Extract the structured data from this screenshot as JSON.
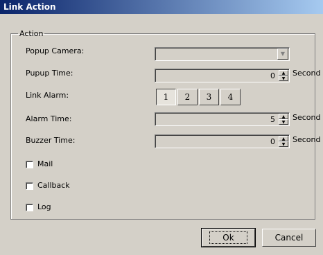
{
  "window": {
    "title": "Link Action"
  },
  "group": {
    "legend": "Action"
  },
  "popup_camera": {
    "label": "Popup Camera:",
    "value": ""
  },
  "popup_time": {
    "label": "Pupup Time:",
    "value": "0",
    "unit": "Second"
  },
  "link_alarm": {
    "label": "Link Alarm:",
    "buttons": [
      "1",
      "2",
      "3",
      "4"
    ],
    "selected": "1"
  },
  "alarm_time": {
    "label": "Alarm Time:",
    "value": "5",
    "unit": "Second"
  },
  "buzzer_time": {
    "label": "Buzzer Time:",
    "value": "0",
    "unit": "Second"
  },
  "checkboxes": [
    {
      "label": "Mail",
      "checked": false
    },
    {
      "label": "Callback",
      "checked": false
    },
    {
      "label": "Log",
      "checked": false
    }
  ],
  "buttons": {
    "ok": "Ok",
    "cancel": "Cancel"
  }
}
